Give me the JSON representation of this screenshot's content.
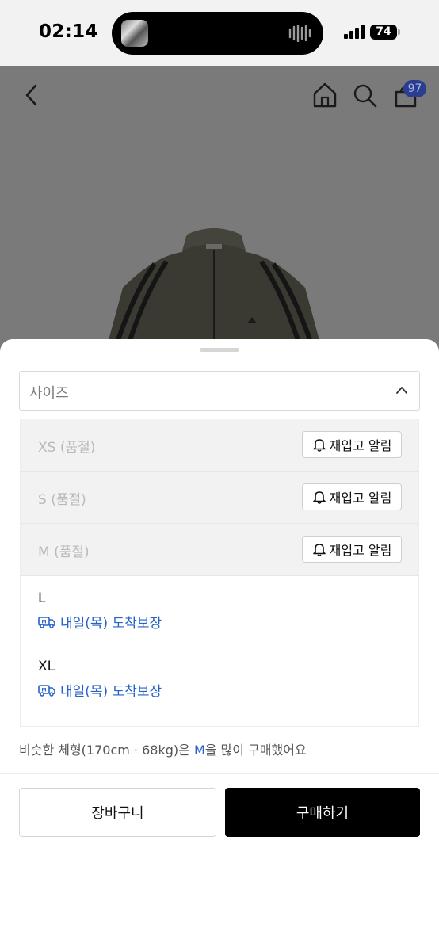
{
  "status_bar": {
    "time": "02:14",
    "battery": "74"
  },
  "product_nav": {
    "cart_count": "97"
  },
  "size_sheet": {
    "dropdown_label": "사이즈",
    "options": [
      {
        "label": "XS (품절)",
        "sold_out": true,
        "action": "재입고 알림"
      },
      {
        "label": "S (품절)",
        "sold_out": true,
        "action": "재입고 알림"
      },
      {
        "label": "M (품절)",
        "sold_out": true,
        "action": "재입고 알림"
      },
      {
        "label": "L",
        "sold_out": false,
        "delivery": "내일(목) 도착보장"
      },
      {
        "label": "XL",
        "sold_out": false,
        "delivery": "내일(목) 도착보장"
      }
    ],
    "recommendation": {
      "prefix": "비슷한 체형(170cm · 68kg)은 ",
      "size": "M",
      "suffix": "을 많이 구매했어요"
    }
  },
  "actions": {
    "cart": "장바구니",
    "buy": "구매하기"
  },
  "colors": {
    "accent_blue": "#2563c9",
    "buy_button": "#000000",
    "badge": "#2b3d8f"
  },
  "icons": [
    "back-icon",
    "home-icon",
    "search-icon",
    "cart-icon",
    "bell-icon",
    "delivery-truck-icon",
    "chevron-up-icon"
  ]
}
